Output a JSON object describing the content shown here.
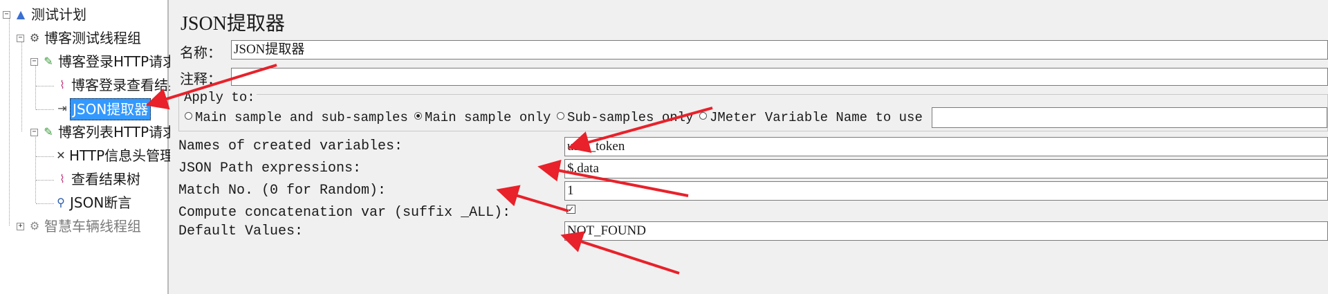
{
  "tree": {
    "items": [
      {
        "label": "测试计划",
        "icon": "flask-icon",
        "toggle": "−"
      },
      {
        "label": "博客测试线程组",
        "icon": "gear-icon",
        "toggle": "−"
      },
      {
        "label": "博客登录HTTP请求",
        "icon": "pen-icon",
        "toggle": "−"
      },
      {
        "label": "博客登录查看结果树",
        "icon": "chart-icon"
      },
      {
        "label": "JSON提取器",
        "icon": "extract-icon",
        "selected": true
      },
      {
        "label": "博客列表HTTP请求",
        "icon": "pen-icon",
        "toggle": "−"
      },
      {
        "label": "HTTP信息头管理器",
        "icon": "wrench-icon"
      },
      {
        "label": "查看结果树",
        "icon": "chart-icon"
      },
      {
        "label": "JSON断言",
        "icon": "magnifier-icon"
      },
      {
        "label": "智慧车辆线程组",
        "icon": "gear-icon",
        "toggle": "+",
        "disabled": true
      }
    ]
  },
  "panel": {
    "title": "JSON提取器",
    "name_label": "名称：",
    "name_value": "JSON提取器",
    "comment_label": "注释：",
    "comment_value": "",
    "apply_to": {
      "legend": "Apply to:",
      "options": [
        "Main sample and sub-samples",
        "Main sample only",
        "Sub-samples only",
        "JMeter Variable Name to use"
      ],
      "selected": "Main sample only",
      "variable_value": ""
    },
    "fields": {
      "names_label": "Names of created variables:",
      "names_value": "user_token",
      "path_label": "JSON Path expressions:",
      "path_value": "$.data",
      "match_label": "Match No. (0 for Random):",
      "match_value": "1",
      "concat_label": "Compute concatenation var (suffix _ALL):",
      "concat_checked": true,
      "default_label": "Default Values:",
      "default_value": "NOT_FOUND"
    }
  },
  "annotation_color": "#e8212a"
}
